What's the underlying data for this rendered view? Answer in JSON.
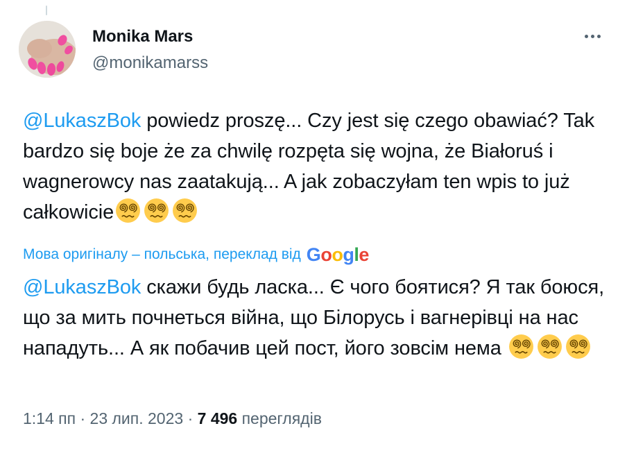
{
  "tweet": {
    "author": {
      "display_name": "Monika Mars",
      "handle": "@monikamarss"
    },
    "original": {
      "mention": "@LukaszBok",
      "text": " powiedz proszę... Czy jest się czego obawiać? Tak bardzo się boje że za chwilę rozpęta się wojna, że Białoruś i wagnerowcy nas zaatakują... A jak zobaczyłam ten wpis to już całkowicie",
      "emoji": [
        "face-with-spiral-eyes",
        "face-with-spiral-eyes",
        "face-with-spiral-eyes"
      ]
    },
    "translation_note": "Мова оригіналу – польська, переклад від",
    "translation_provider": {
      "letters": [
        "G",
        "o",
        "o",
        "g",
        "l",
        "e"
      ],
      "colors": [
        "#4285f4",
        "#ea4335",
        "#fbbc05",
        "#4285f4",
        "#34a853",
        "#ea4335"
      ]
    },
    "translated": {
      "mention": "@LukaszBok",
      "text": " скажи будь ласка... Є чого боятися? Я так боюся, що за мить почнеться війна, що Білорусь і вагнерівці на нас нападуть... А як побачив цей пост, його зовсім нема ",
      "emoji": [
        "face-with-spiral-eyes",
        "face-with-spiral-eyes",
        "face-with-spiral-eyes"
      ]
    },
    "meta": {
      "time": "1:14 пп",
      "separator": " · ",
      "date": "23 лип. 2023",
      "separator2": " · ",
      "views": "7 496",
      "views_label": " переглядів"
    }
  },
  "colors": {
    "accent": "#1d9bf0",
    "text": "#0f1419",
    "secondary": "#536471"
  },
  "icons": {
    "more": "more-horizontal-icon",
    "emoji": "face-with-spiral-eyes"
  }
}
